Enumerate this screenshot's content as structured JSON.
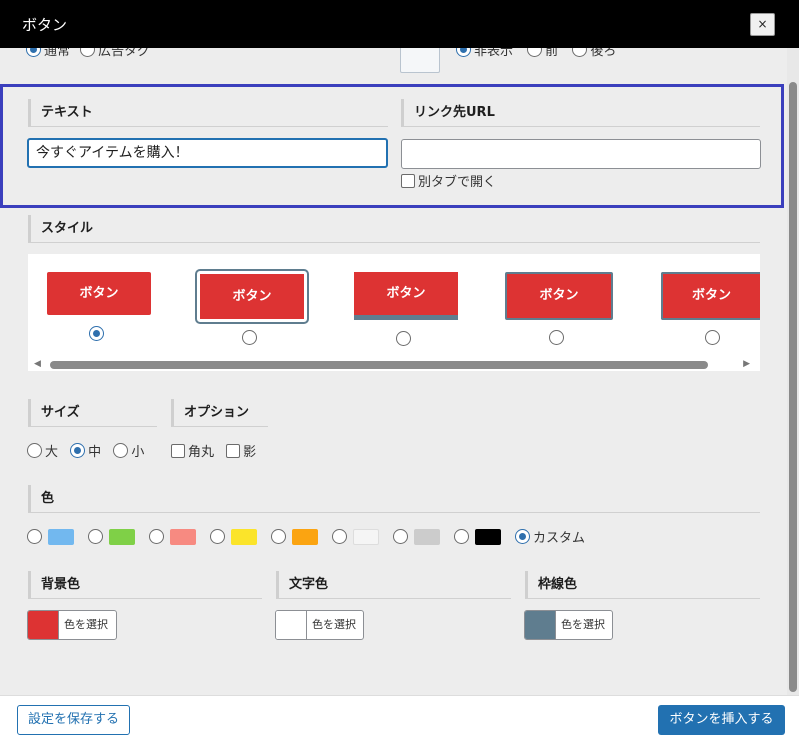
{
  "dialog": {
    "title": "ボタン",
    "close_label": "×"
  },
  "top_row": {
    "options_left": [
      {
        "label": "通常",
        "selected": true
      },
      {
        "label": "広告タグ",
        "selected": false
      }
    ],
    "options_right": [
      {
        "label": "非表示",
        "selected": true
      },
      {
        "label": "前",
        "selected": false
      },
      {
        "label": "後ろ",
        "selected": false
      }
    ]
  },
  "text_section": {
    "label": "テキスト",
    "value": "今すぐアイテムを購入！"
  },
  "url_section": {
    "label": "リンク先URL",
    "value": "",
    "new_tab_label": "別タブで開く"
  },
  "style_section": {
    "label": "スタイル",
    "buttons": [
      {
        "label": "ボタン",
        "selected": true
      },
      {
        "label": "ボタン",
        "selected": false
      },
      {
        "label": "ボタン",
        "selected": false
      },
      {
        "label": "ボタン",
        "selected": false
      },
      {
        "label": "ボタン",
        "selected": false
      }
    ],
    "button_color": "#dd3333"
  },
  "size_section": {
    "label": "サイズ",
    "options": [
      {
        "label": "大",
        "selected": false
      },
      {
        "label": "中",
        "selected": true
      },
      {
        "label": "小",
        "selected": false
      }
    ]
  },
  "option_section": {
    "label": "オプション",
    "options": [
      {
        "label": "角丸",
        "checked": false
      },
      {
        "label": "影",
        "checked": false
      }
    ]
  },
  "color_section": {
    "label": "色",
    "swatches": [
      "#72b8ef",
      "#7fd047",
      "#f78a81",
      "#fbe42a",
      "#fba411",
      "#f5f5f5",
      "#cccccc",
      "#000000"
    ],
    "custom_label": "カスタム",
    "custom_selected": true
  },
  "pickers": [
    {
      "label": "背景色",
      "button_label": "色を選択",
      "color": "#dd3333"
    },
    {
      "label": "文字色",
      "button_label": "色を選択",
      "color": "#ffffff"
    },
    {
      "label": "枠線色",
      "button_label": "色を選択",
      "color": "#5f7d8f"
    }
  ],
  "footer": {
    "save_label": "設定を保存する",
    "insert_label": "ボタンを挿入する"
  },
  "colors": {
    "accent": "#2271b1",
    "highlight_border": "#3b3fbd"
  }
}
